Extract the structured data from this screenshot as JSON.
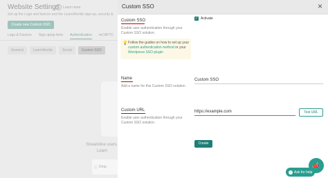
{
  "background": {
    "title": "Website Settings",
    "learn_more": "Learn more",
    "subtitle": "Set up the Logo and favicon and the LearnWorlds sign-up, security &",
    "create_button": "Create new Custom SSO",
    "tabs": [
      "Logo & Favicon",
      "Sign up/up form",
      "Authentication",
      "reCAPTC"
    ],
    "subtabs": [
      "General",
      "LearnWorlds",
      "Social",
      "Custom SSO"
    ],
    "streamline": "Streamline users",
    "learn_short": "Learn",
    "toast": "Drop"
  },
  "panel": {
    "title": "Custom SSO",
    "close": "×",
    "section1": {
      "label": "Custom SSO",
      "description": "Enable user authentication through your Custom SSO solution.",
      "checkbox_label": "Activate",
      "info_prefix": "Follow the guides on how to set up your ",
      "info_link1": "custom authentication method",
      "info_middle": " or your ",
      "info_link2": "Wordpress SSO plugin"
    },
    "section2": {
      "label": "Name",
      "description": "Add a name for this Custom SSO solution.",
      "value": "Custom SSO"
    },
    "section3": {
      "label": "Custom URL",
      "description": "Enable user authentication through your Custom SSO solution.",
      "value": "https://example.com",
      "test_button": "Test URL"
    },
    "create_button": "Create"
  },
  "help": {
    "label": "Ask for help"
  },
  "colors": {
    "accent": "#1e7f74",
    "underline": "#cc0000"
  }
}
